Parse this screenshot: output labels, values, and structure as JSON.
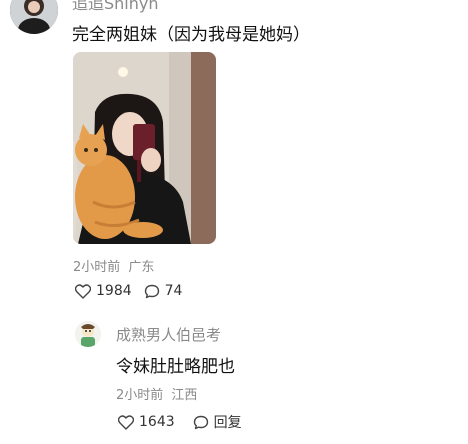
{
  "main_comment": {
    "username": "追追Shinyh",
    "text": "完全两姐妹（因为我母是她妈）",
    "time": "2小时前",
    "location": "广东",
    "likes": "1984",
    "comments": "74"
  },
  "reply": {
    "username": "成熟男人伯邑考",
    "text": "令妹肚肚略肥也",
    "time": "2小时前",
    "location": "江西",
    "likes": "1643",
    "reply_label": "回复"
  },
  "icons": {
    "like": "heart-outline-icon",
    "comment": "speech-bubble-icon"
  },
  "colors": {
    "meta_gray": "#8a8a8a",
    "text_dark": "#111111",
    "background": "#ffffff"
  }
}
